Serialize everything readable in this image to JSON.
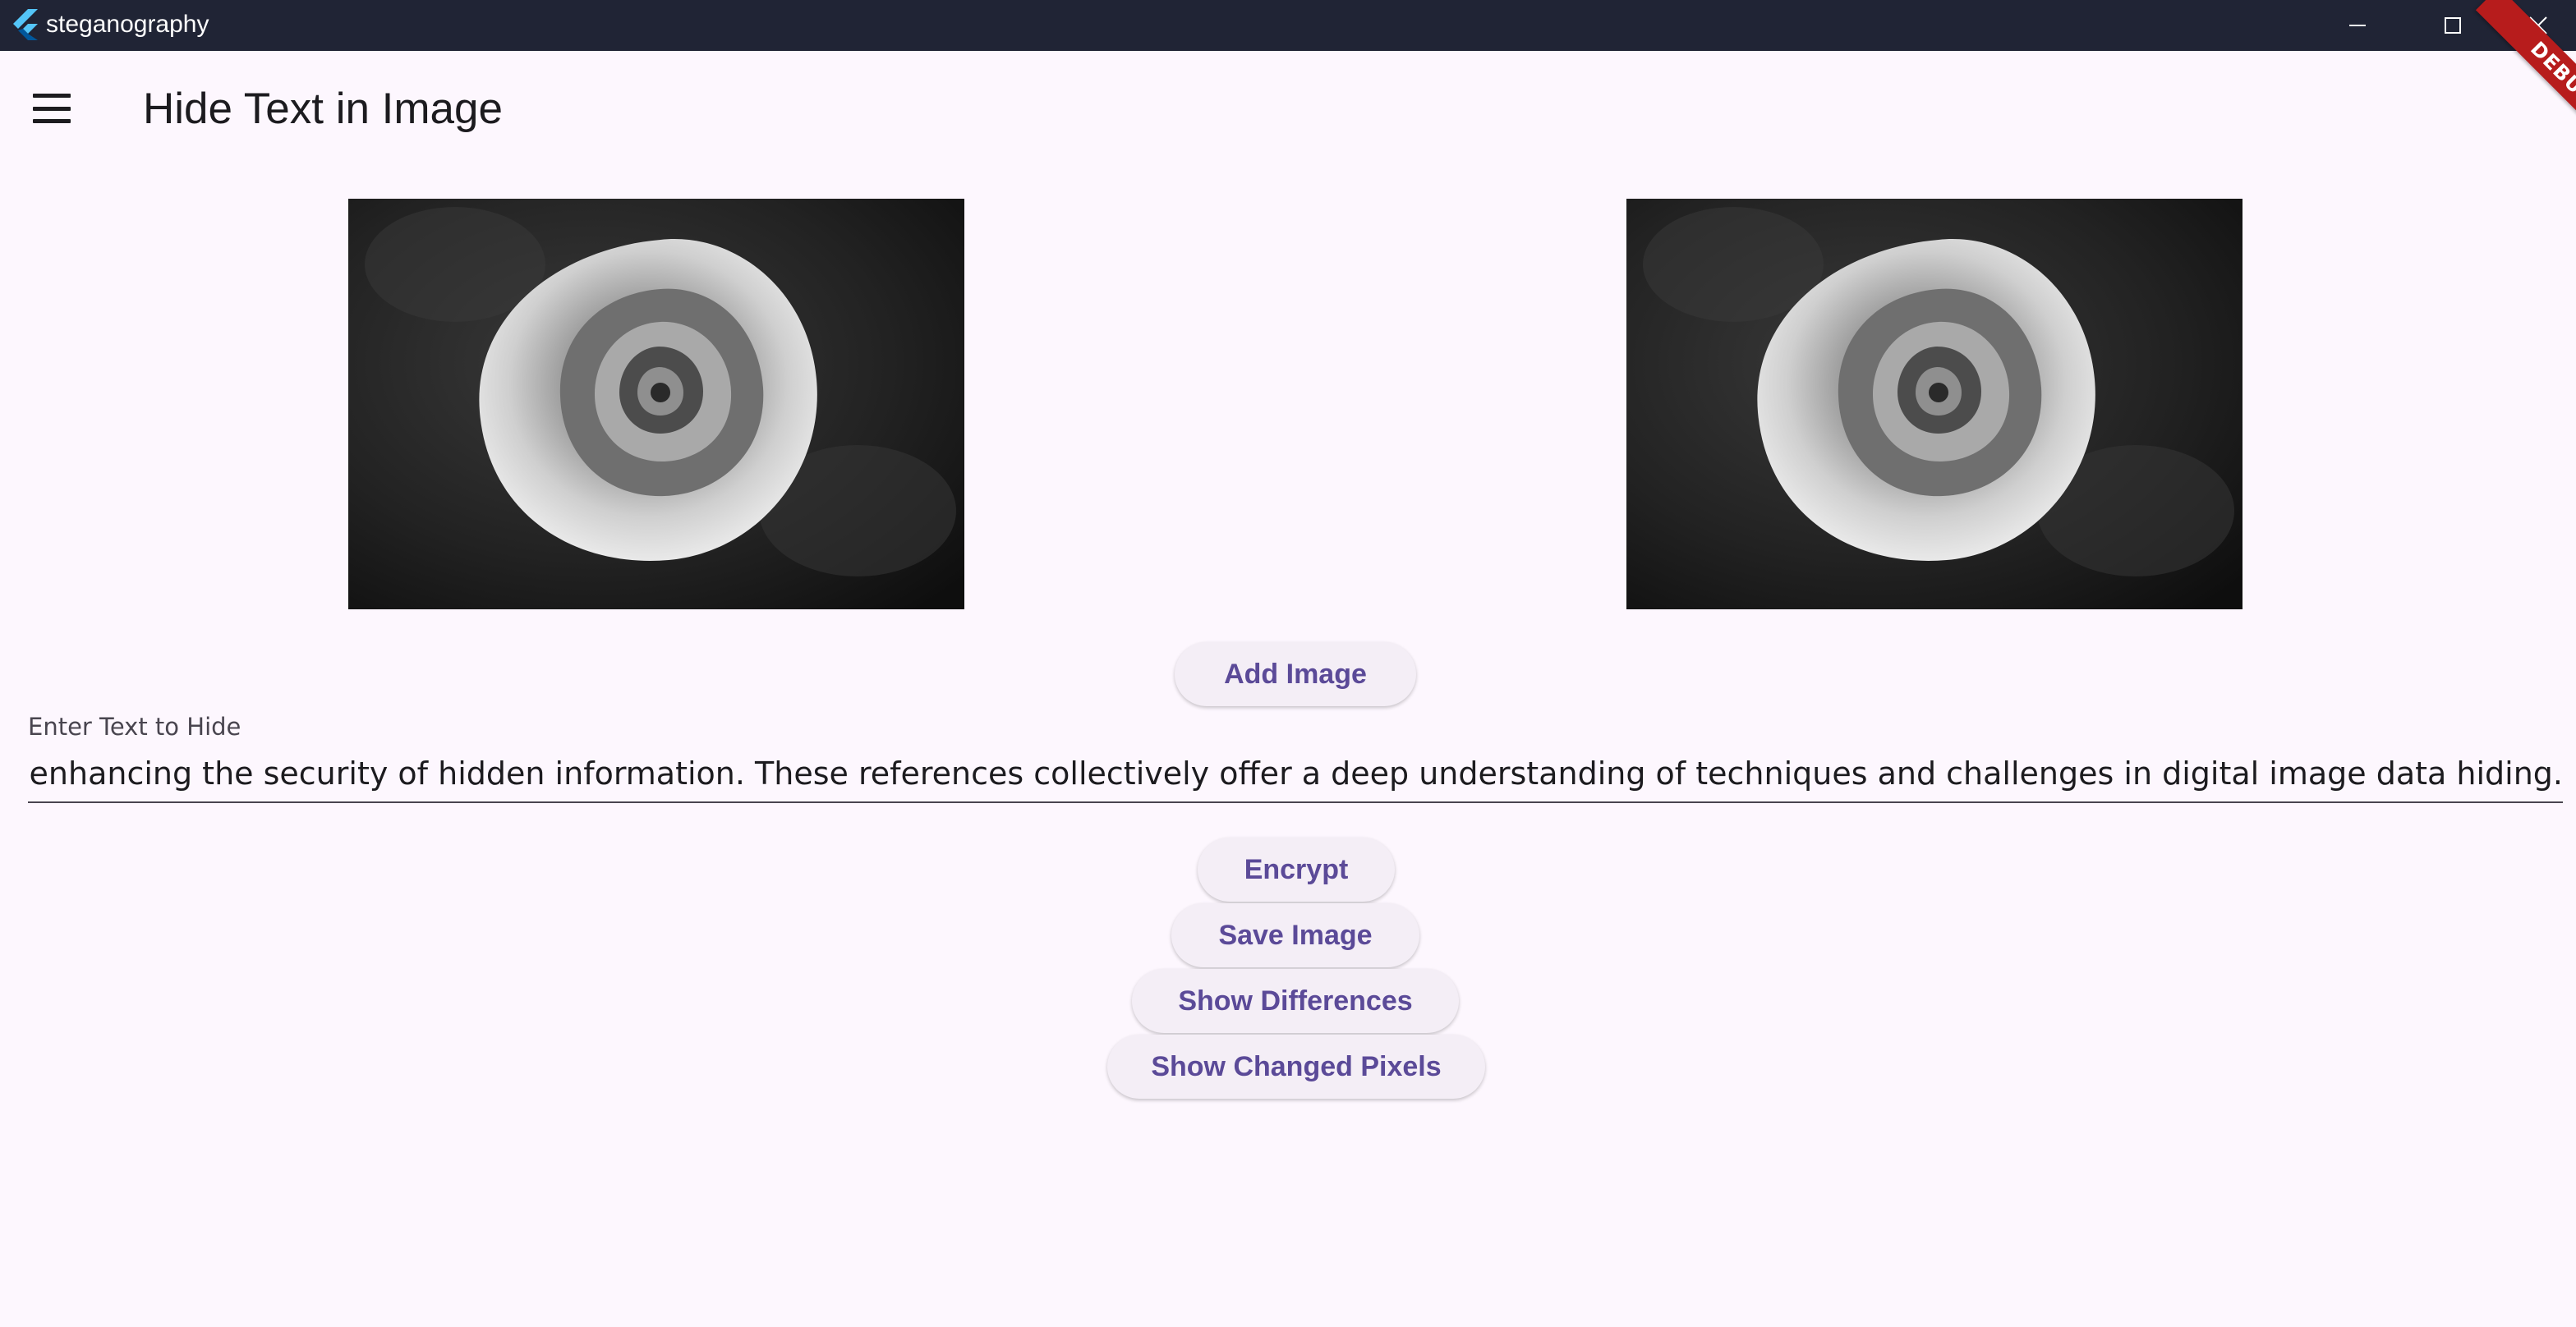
{
  "window": {
    "app_title": "steganography",
    "controls": {
      "minimize": "minimize-icon",
      "maximize": "maximize-icon",
      "close": "close-icon"
    }
  },
  "app_bar": {
    "menu_icon": "menu-icon",
    "title": "Hide Text in Image"
  },
  "debug_banner": "DEBUG",
  "images": {
    "original": "rose-grayscale-image",
    "encoded": "rose-grayscale-image"
  },
  "buttons": {
    "add_image": "Add Image",
    "encrypt": "Encrypt",
    "save_image": "Save Image",
    "show_differences": "Show Differences",
    "show_changed_pixels": "Show Changed Pixels"
  },
  "text_field": {
    "label": "Enter Text to Hide",
    "value": "es, enhancing the security of hidden information. These references collectively offer a deep understanding of techniques and challenges in digital image data hiding."
  },
  "colors": {
    "titlebar": "#202435",
    "background": "#fdf7fe",
    "button_bg": "#f4eef6",
    "button_text": "#5b4a98",
    "debug_banner": "#b71c1c"
  }
}
